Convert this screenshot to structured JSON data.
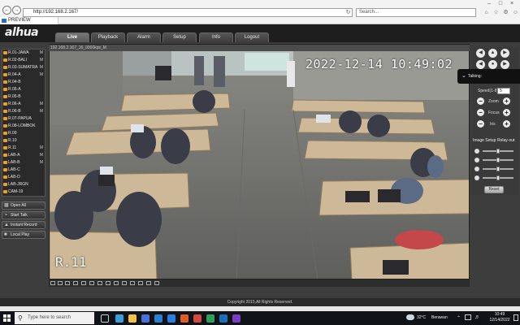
{
  "browser": {
    "address": "http://192.168.2.167/",
    "search_placeholder": "Search...",
    "tab_title": "PREVIEW"
  },
  "app": {
    "logo": "alhua",
    "nav_tabs": [
      {
        "label": "Live",
        "active": true
      },
      {
        "label": "Playback",
        "active": false
      },
      {
        "label": "Alarm",
        "active": false
      },
      {
        "label": "Setup",
        "active": false
      },
      {
        "label": "Info",
        "active": false
      },
      {
        "label": "Logout",
        "active": false
      }
    ]
  },
  "channels": [
    {
      "label": "R.01-JAWA",
      "stream": "M"
    },
    {
      "label": "R.02-BALI",
      "stream": "M"
    },
    {
      "label": "R.03-SUMATRA",
      "stream": "M"
    },
    {
      "label": "R.04-A",
      "stream": "M"
    },
    {
      "label": "R.04-B",
      "stream": ""
    },
    {
      "label": "R.05-A",
      "stream": ""
    },
    {
      "label": "R.05-B",
      "stream": ""
    },
    {
      "label": "R.06-A",
      "stream": "M"
    },
    {
      "label": "R.06-B",
      "stream": "M"
    },
    {
      "label": "R.07-PAPUA",
      "stream": ""
    },
    {
      "label": "R.08-LOMBOK",
      "stream": ""
    },
    {
      "label": "R.09",
      "stream": ""
    },
    {
      "label": "R.10",
      "stream": ""
    },
    {
      "label": "R.11",
      "stream": "M"
    },
    {
      "label": "LAB-A",
      "stream": "M"
    },
    {
      "label": "LAB-B",
      "stream": "M"
    },
    {
      "label": "LAB-C",
      "stream": ""
    },
    {
      "label": "LAB-D",
      "stream": ""
    },
    {
      "label": "LAB-JRGN",
      "stream": ""
    },
    {
      "label": "CAM-19",
      "stream": ""
    }
  ],
  "left_buttons": {
    "open_all": "Open All",
    "start_talk": "Start Talk",
    "instant_record": "Instant Record",
    "local_play": "Local Play"
  },
  "video": {
    "title": "192.168.2.167_16_0000kps_M",
    "timestamp": "2022-12-14 10:49:02",
    "camera_name": "R.11"
  },
  "ptz": {
    "talking": "Talking:",
    "speed_label": "Speed(1-8)",
    "speed_value": "5",
    "zoom": "Zoom",
    "focus": "Focus",
    "iris": "Iris"
  },
  "image_setup": {
    "title": "Image Setup",
    "relay_out": "Relay-out",
    "reset": "Reset",
    "sliders": [
      0.5,
      0.5,
      0.5,
      0.5
    ]
  },
  "footer": {
    "copyright": "Copyright 2015,All Rights Reserved."
  },
  "taskbar": {
    "search_placeholder": "Type here to search",
    "weather_temp": "32°C",
    "weather_text": "Berawan",
    "time": "10:49",
    "date": "12/14/2022"
  }
}
